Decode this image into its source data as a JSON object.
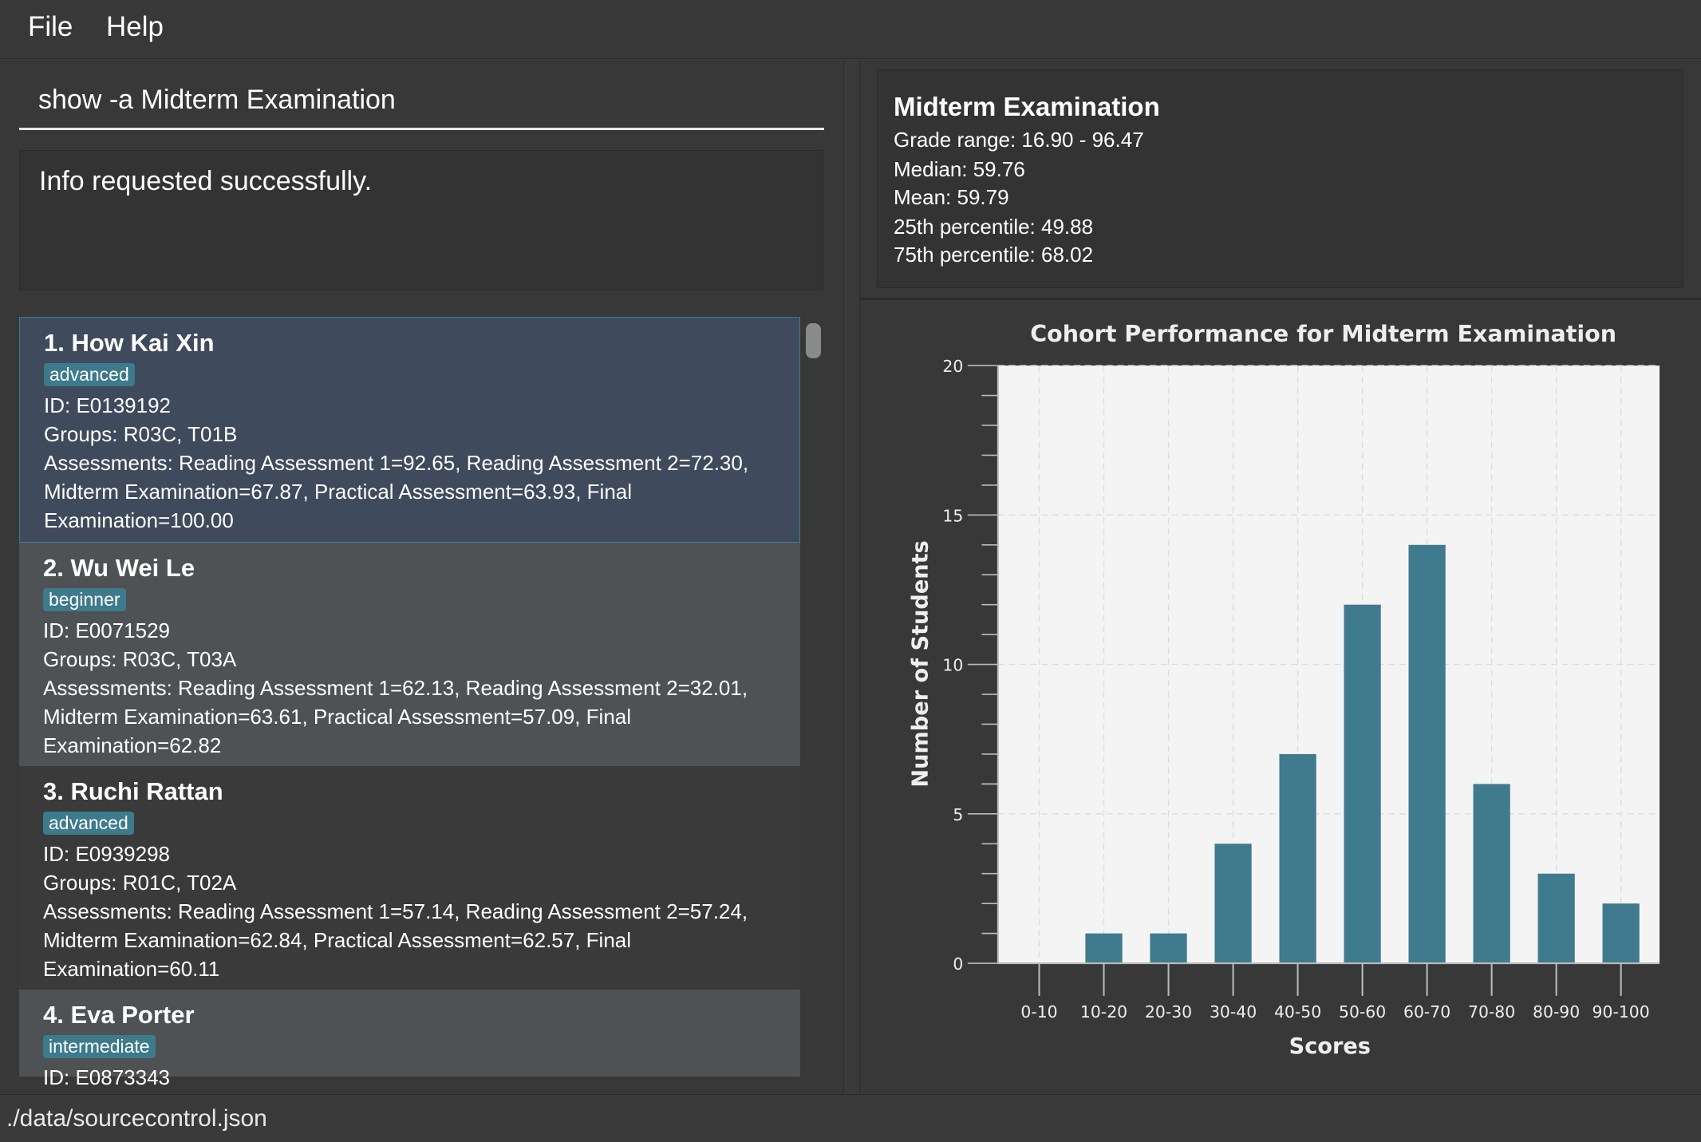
{
  "menu": {
    "file": "File",
    "help": "Help"
  },
  "command": {
    "value": "show -a Midterm Examination"
  },
  "result": {
    "message": "Info requested successfully."
  },
  "students": [
    {
      "name": "1.  How Kai Xin",
      "tag": "advanced",
      "id": "ID: E0139192",
      "groups": "Groups: R03C, T01B",
      "assessments": "Assessments: Reading Assessment 1=92.65, Reading Assessment 2=72.30, Midterm Examination=67.87, Practical Assessment=63.93, Final Examination=100.00"
    },
    {
      "name": "2.  Wu Wei Le",
      "tag": "beginner",
      "id": "ID: E0071529",
      "groups": "Groups: R03C, T03A",
      "assessments": "Assessments: Reading Assessment 1=62.13, Reading Assessment 2=32.01, Midterm Examination=63.61, Practical Assessment=57.09, Final Examination=62.82"
    },
    {
      "name": "3.  Ruchi Rattan",
      "tag": "advanced",
      "id": "ID: E0939298",
      "groups": "Groups: R01C, T02A",
      "assessments": "Assessments: Reading Assessment 1=57.14, Reading Assessment 2=57.24, Midterm Examination=62.84, Practical Assessment=62.57, Final Examination=60.11"
    },
    {
      "name": "4.  Eva Porter",
      "tag": "intermediate",
      "id": "ID: E0873343",
      "groups": "",
      "assessments": ""
    }
  ],
  "stats": {
    "title": "Midterm Examination",
    "range": "Grade range: 16.90 - 96.47",
    "median": "Median: 59.76",
    "mean": "Mean: 59.79",
    "p25": "25th percentile: 49.88",
    "p75": "75th percentile: 68.02"
  },
  "status": {
    "path": "./data/sourcecontrol.json"
  },
  "colors": {
    "bar": "#3f7a8f",
    "tag": "#3d7a8c",
    "selected_card": "#3f4a5c",
    "selected_border": "#3a7d94"
  },
  "chart_data": {
    "type": "bar",
    "title": "Cohort Performance for Midterm Examination",
    "xlabel": "Scores",
    "ylabel": "Number of Students",
    "categories": [
      "0-10",
      "10-20",
      "20-30",
      "30-40",
      "40-50",
      "50-60",
      "60-70",
      "70-80",
      "80-90",
      "90-100"
    ],
    "values": [
      0,
      1,
      1,
      4,
      7,
      12,
      14,
      6,
      3,
      2
    ],
    "ylim": [
      0,
      20
    ],
    "yticks": [
      0,
      5,
      10,
      15,
      20
    ],
    "grid": true,
    "legend": "none"
  }
}
